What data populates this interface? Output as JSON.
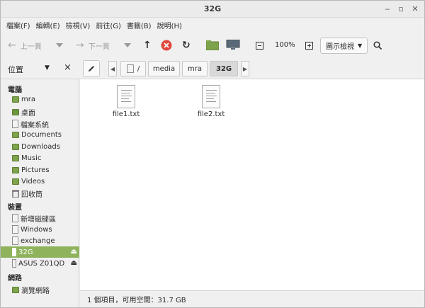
{
  "window": {
    "title": "32G"
  },
  "menubar": [
    "檔案(F)",
    "編輯(E)",
    "檢視(V)",
    "前往(G)",
    "書籤(B)",
    "說明(H)"
  ],
  "toolbar": {
    "back_label": "上一頁",
    "forward_label": "下一頁",
    "zoom": "100%",
    "view_mode": "圖示檢視"
  },
  "sidebar": {
    "selector_label": "位置",
    "sections": {
      "computer": "電腦",
      "devices": "裝置",
      "network": "網路"
    },
    "computer_items": [
      "mra",
      "桌面",
      "檔案系統",
      "Documents",
      "Downloads",
      "Music",
      "Pictures",
      "Videos",
      "回收筒"
    ],
    "device_items": [
      "新增磁碟區",
      "Windows",
      "exchange",
      "32G",
      "ASUS Z01QD"
    ],
    "network_items": [
      "瀏覽網路"
    ]
  },
  "breadcrumb": [
    "/",
    "media",
    "mra",
    "32G"
  ],
  "files": [
    "file1.txt",
    "file2.txt"
  ],
  "status": "1 個項目，可用空間：31.7 GB",
  "colors": {
    "selection": "#8fb35d",
    "folder": "#7ea34c",
    "stop": "#e0473c"
  }
}
